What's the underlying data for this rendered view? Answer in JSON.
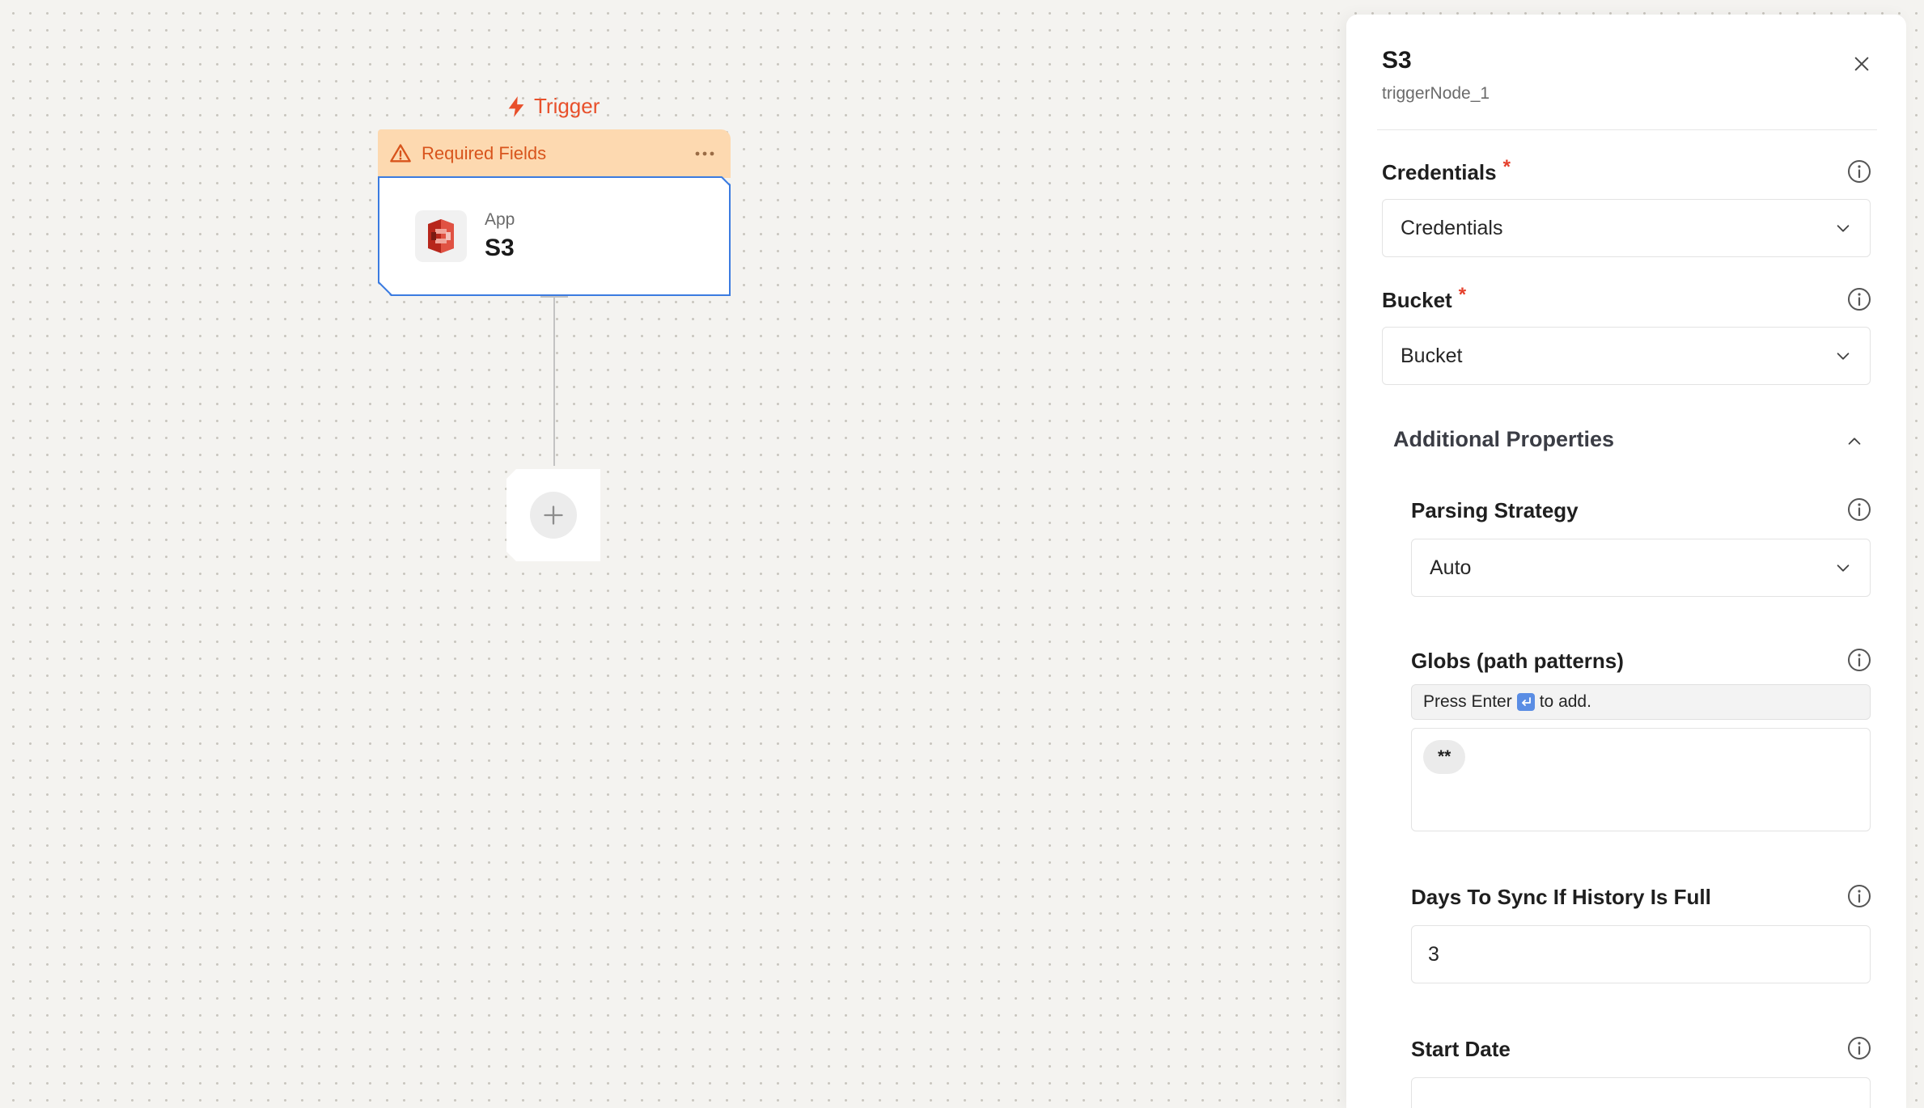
{
  "canvas": {
    "trigger_label": "Trigger",
    "node": {
      "warning_text": "Required Fields",
      "app_kind": "App",
      "app_name": "S3"
    }
  },
  "panel": {
    "title": "S3",
    "subtitle": "triggerNode_1",
    "fields": {
      "credentials": {
        "label": "Credentials",
        "required_mark": "*",
        "value": "Credentials"
      },
      "bucket": {
        "label": "Bucket",
        "required_mark": "*",
        "value": "Bucket"
      }
    },
    "additional": {
      "title": "Additional Properties",
      "parsing_strategy": {
        "label": "Parsing Strategy",
        "value": "Auto"
      },
      "globs": {
        "label": "Globs (path patterns)",
        "hint_prefix": "Press Enter",
        "hint_suffix": "to add.",
        "tags": [
          "**"
        ]
      },
      "days_to_sync": {
        "label": "Days To Sync If History Is Full",
        "value": "3"
      },
      "start_date": {
        "label": "Start Date"
      }
    }
  },
  "colors": {
    "accent_orange": "#e8502b",
    "warning_bg": "#fdd9b0",
    "selected_border": "#3b7be0",
    "required_red": "#e5402c"
  }
}
